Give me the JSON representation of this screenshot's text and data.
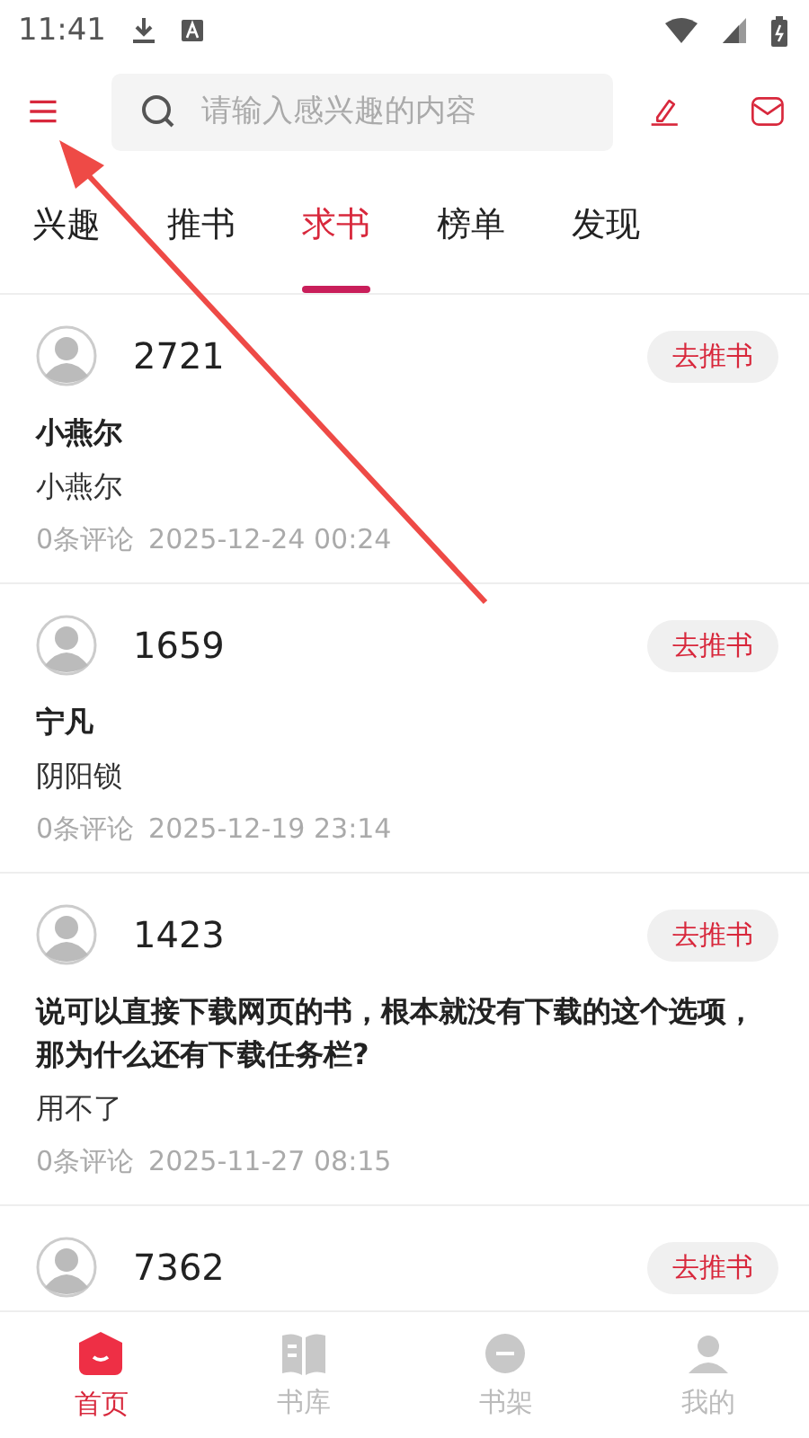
{
  "status_bar": {
    "time": "11:41"
  },
  "search": {
    "placeholder": "请输入感兴趣的内容"
  },
  "tabs": [
    {
      "label": "兴趣",
      "selected": false
    },
    {
      "label": "推书",
      "selected": false
    },
    {
      "label": "求书",
      "selected": true
    },
    {
      "label": "榜单",
      "selected": false
    },
    {
      "label": "发现",
      "selected": false
    }
  ],
  "posts": [
    {
      "count": "2721",
      "button": "去推书",
      "title": "小燕尔",
      "subtitle": "小燕尔",
      "comments": "0条评论",
      "time": "2025-12-24 00:24"
    },
    {
      "count": "1659",
      "button": "去推书",
      "title": "宁凡",
      "subtitle": "阴阳锁",
      "comments": "0条评论",
      "time": "2025-12-19 23:14"
    },
    {
      "count": "1423",
      "button": "去推书",
      "title": "说可以直接下载网页的书，根本就没有下载的这个选项，那为什么还有下载任务栏?",
      "subtitle": "用不了",
      "comments": "0条评论",
      "time": "2025-11-27 08:15"
    },
    {
      "count": "7362",
      "button": "去推书"
    }
  ],
  "nav": [
    {
      "label": "首页",
      "kind": "home",
      "selected": true
    },
    {
      "label": "书库",
      "kind": "library",
      "selected": false
    },
    {
      "label": "书架",
      "kind": "shelf",
      "selected": false
    },
    {
      "label": "我的",
      "kind": "profile",
      "selected": false
    }
  ]
}
